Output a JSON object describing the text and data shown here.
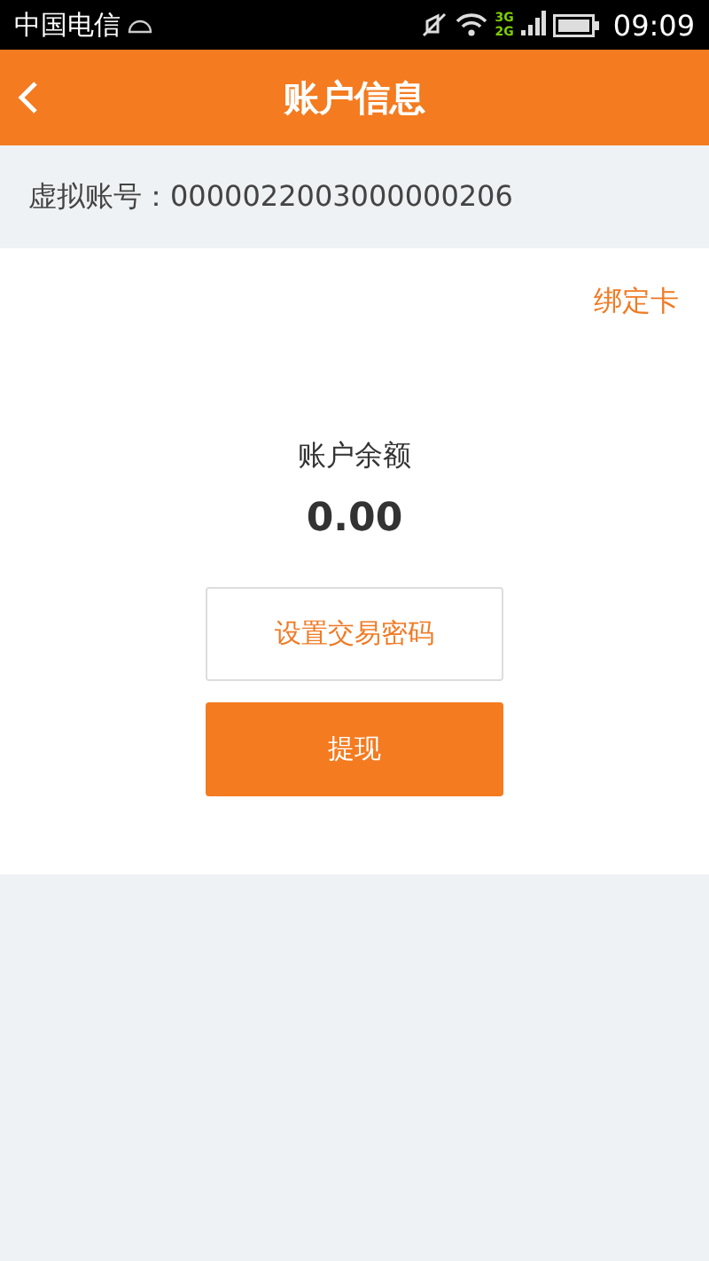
{
  "status_bar": {
    "carrier": "中国电信",
    "network_labels": [
      "3G",
      "2G"
    ],
    "time": "09:09"
  },
  "header": {
    "title": "账户信息"
  },
  "account": {
    "text": "虚拟账号：0000022003000000206"
  },
  "bind_card_link": "绑定卡",
  "balance": {
    "label": "账户余额",
    "amount": "0.00"
  },
  "buttons": [
    {
      "label": "设置交易密码",
      "kind": "outline"
    },
    {
      "label": "提现",
      "kind": "primary"
    }
  ]
}
